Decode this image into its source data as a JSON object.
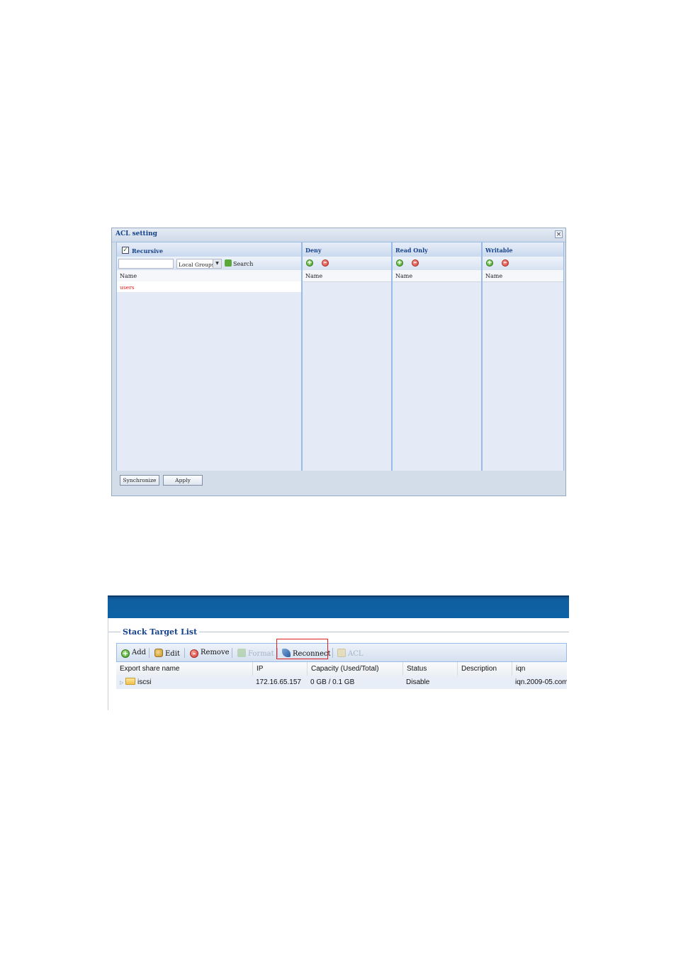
{
  "acl_window": {
    "title": "ACL setting",
    "close_symbol": "×",
    "users_panel": {
      "recursive_label": "Recursive",
      "recursive_checked": true,
      "group_select_value": "Local Groups",
      "search_label": "Search",
      "column_name": "Name",
      "items": [
        "users"
      ]
    },
    "deny_panel": {
      "title": "Deny",
      "column_name": "Name"
    },
    "read_only_panel": {
      "title": "Read Only",
      "column_name": "Name"
    },
    "writable_panel": {
      "title": "Writable",
      "column_name": "Name"
    },
    "buttons": {
      "synchronize": "Synchronize",
      "apply": "Apply"
    }
  },
  "stack_target_list": {
    "title": "Stack Target List",
    "toolbar": {
      "add": "Add",
      "edit": "Edit",
      "remove": "Remove",
      "format": "Format",
      "reconnect": "Reconnect",
      "acl": "ACL"
    },
    "columns": [
      "Export share name",
      "IP",
      "Capacity (Used/Total)",
      "Status",
      "Description",
      "iqn"
    ],
    "rows": [
      {
        "export_share_name": "iscsi",
        "ip": "172.16.65.157",
        "capacity": "0 GB / 0.1 GB",
        "status": "Disable",
        "description": "",
        "iqn": "iqn.2009-05.com"
      }
    ]
  },
  "colors": {
    "banner_blue": "#0d62a6",
    "title_blue": "#15428b",
    "highlight_red": "#e0201f",
    "user_item_red": "#e02020"
  }
}
